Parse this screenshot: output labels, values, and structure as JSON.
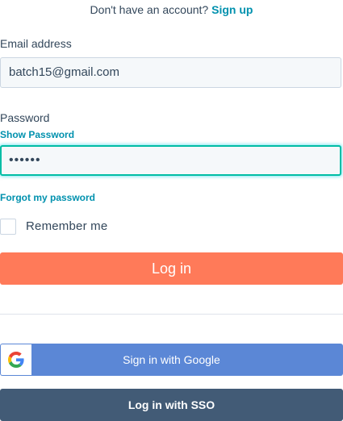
{
  "signup_prompt": {
    "text": "Don't have an account?",
    "link": "Sign up"
  },
  "email": {
    "label": "Email address",
    "value": "batch15@gmail.com"
  },
  "password": {
    "label": "Password",
    "show_password": "Show Password",
    "masked_value": "••••••"
  },
  "forgot_password": "Forgot my password",
  "remember_me": {
    "label": "Remember me",
    "checked": false
  },
  "login_button": "Log in",
  "google_button": "Sign in with Google",
  "sso_button": "Log in with SSO",
  "colors": {
    "accent_link": "#0091ae",
    "login_button": "#ff7a59",
    "google_button": "#5b87d6",
    "sso_button": "#425b76",
    "focus_border": "#00bda5"
  },
  "icons": {
    "google": "google-g-icon"
  }
}
